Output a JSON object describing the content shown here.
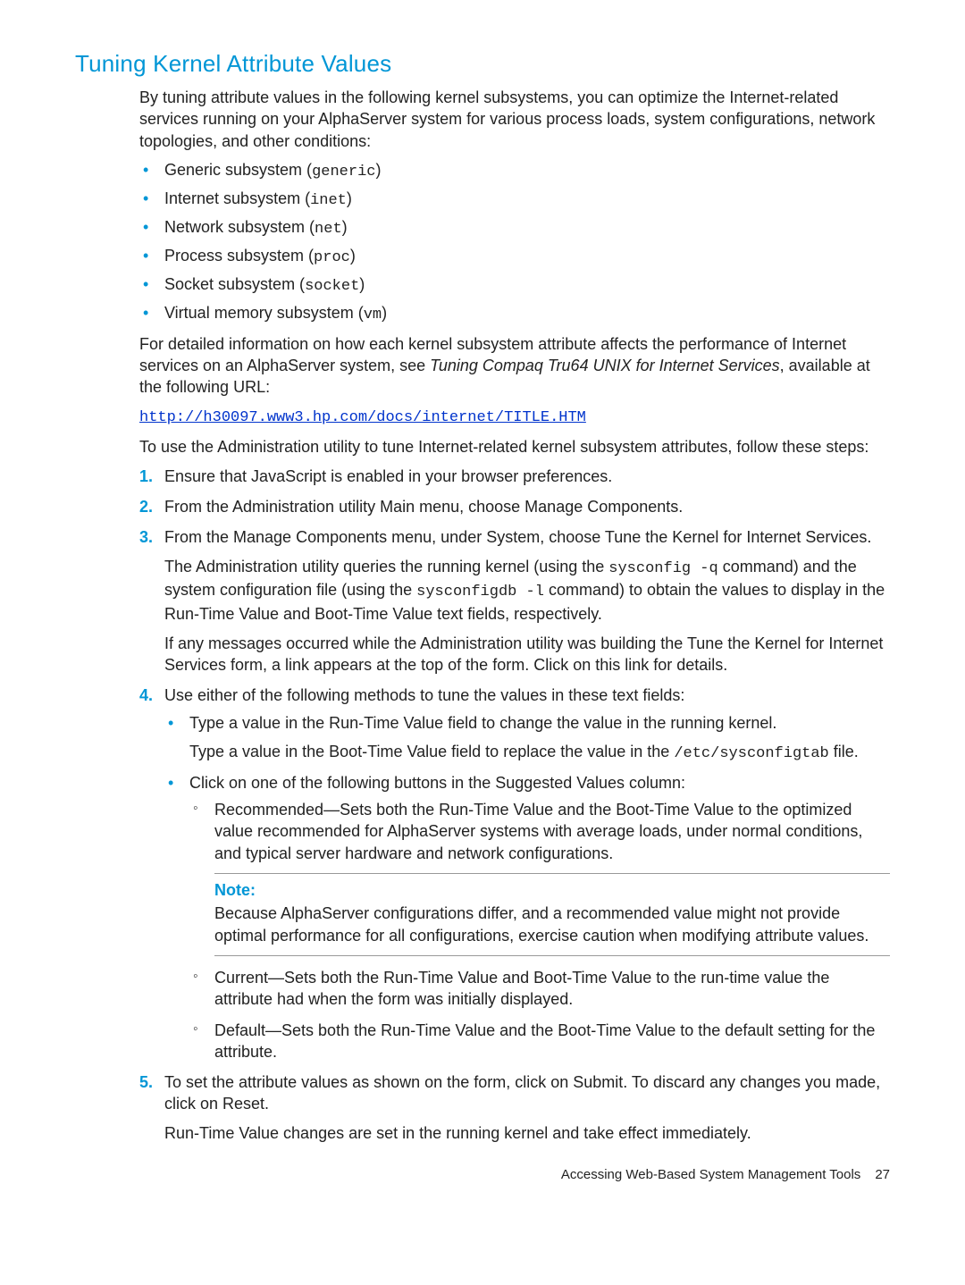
{
  "heading": "Tuning Kernel Attribute Values",
  "intro": "By tuning attribute values in the following kernel subsystems, you can optimize the Internet-related services running on your AlphaServer system for various process loads, system configurations, network topologies, and other conditions:",
  "subsystems": [
    {
      "label": "Generic subsystem (",
      "code": "generic",
      "tail": ")"
    },
    {
      "label": "Internet subsystem (",
      "code": "inet",
      "tail": ")"
    },
    {
      "label": "Network subsystem (",
      "code": "net",
      "tail": ")"
    },
    {
      "label": "Process subsystem (",
      "code": "proc",
      "tail": ")"
    },
    {
      "label": "Socket subsystem (",
      "code": "socket",
      "tail": ")"
    },
    {
      "label": "Virtual memory subsystem (",
      "code": "vm",
      "tail": ")"
    }
  ],
  "detail_lead": "For detailed information on how each kernel subsystem attribute affects the performance of Internet services on an AlphaServer system, see ",
  "detail_doc_title": "Tuning Compaq Tru64 UNIX for Internet Services",
  "detail_trail": ", available at the following URL:",
  "url": "http://h30097.www3.hp.com/docs/internet/TITLE.HTM",
  "steps_intro": "To use the Administration utility to tune Internet-related kernel subsystem attributes, follow these steps:",
  "steps": {
    "s1": "Ensure that JavaScript is enabled in your browser preferences.",
    "s2": "From the Administration utility Main menu, choose Manage Components.",
    "s3_a": "From the Manage Components menu, under System, choose Tune the Kernel for Internet Services.",
    "s3_b_pre": "The Administration utility queries the running kernel (using the ",
    "s3_b_cmd1": "sysconfig -q",
    "s3_b_mid": " command) and the system configuration file (using the ",
    "s3_b_cmd2": "sysconfigdb -l",
    "s3_b_post": " command) to obtain the values to display in the Run-Time Value and Boot-Time Value text fields, respectively.",
    "s3_c": "If any messages occurred while the Administration utility was building the Tune the Kernel for Internet Services form, a link appears at the top of the form. Click on this link for details.",
    "s4": "Use either of the following methods to tune the values in these text fields:",
    "s4_m1_a": "Type a value in the Run-Time Value field to change the value in the running kernel.",
    "s4_m1_b_pre": "Type a value in the Boot-Time Value field to replace the value in the ",
    "s4_m1_b_code": "/etc/sysconfigtab",
    "s4_m1_b_post": " file.",
    "s4_m2": "Click on one of the following buttons in the Suggested Values column:",
    "s4_m2_rec": "Recommended—Sets both the Run-Time Value and the Boot-Time Value to the optimized value recommended for AlphaServer systems with average loads, under normal conditions, and typical server hardware and network configurations.",
    "note_label": "Note:",
    "note_body": "Because AlphaServer configurations differ, and a recommended value might not provide optimal performance for all configurations, exercise caution when modifying attribute values.",
    "s4_m2_cur": "Current—Sets both the Run-Time Value and Boot-Time Value to the run-time value the attribute had when the form was initially displayed.",
    "s4_m2_def": "Default—Sets both the Run-Time Value and the Boot-Time Value to the default setting for the attribute.",
    "s5_a": "To set the attribute values as shown on the form, click on Submit. To discard any changes you made, click on Reset.",
    "s5_b": "Run-Time Value changes are set in the running kernel and take effect immediately."
  },
  "footer": {
    "title": "Accessing Web-Based System Management Tools",
    "page": "27"
  }
}
